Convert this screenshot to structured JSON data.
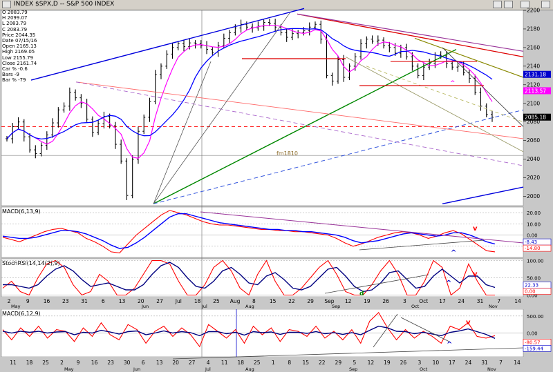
{
  "header": {
    "title": "INDEX $SPX,D -- S&P 500 INDEX",
    "buttons": [
      "link-icon",
      "settings-icon",
      "zoom-icon",
      "close-icon"
    ]
  },
  "readout": [
    {
      "label": "Price",
      "value": "2044.35"
    },
    {
      "label": "Date",
      "value": "07/15/16"
    },
    {
      "label": "Open",
      "value": "2165.13"
    },
    {
      "label": "High",
      "value": "2169.05"
    },
    {
      "label": "Low",
      "value": "2155.79"
    },
    {
      "label": "Close",
      "value": "2161.74"
    },
    {
      "label": "Car %",
      "value": "-0.6"
    },
    {
      "label": "Bars",
      "value": "-9"
    },
    {
      "label": "Bar %",
      "value": "-79"
    }
  ],
  "ohlc_box": {
    "O": "2083.79",
    "H": "2099.07",
    "L": "2083.79",
    "C": "2083.79"
  },
  "chart_data": [
    {
      "type": "candlestick",
      "title": "INDEX $SPX,D -- S&P 500 INDEX",
      "ylim": [
        1990,
        2200
      ],
      "y_ticks": [
        2000,
        2020,
        2040,
        2060,
        2080,
        2100,
        2120,
        2140,
        2160,
        2180,
        2200
      ],
      "price_labels": [
        {
          "text": "2131.18",
          "color": "#0000cc"
        },
        {
          "text": "2113.57",
          "color": "#ff00ff"
        },
        {
          "text": "2085.18",
          "color": "#000000"
        }
      ],
      "annotations": [
        "fm1810"
      ],
      "x_ticks_top": [
        "2",
        "9",
        "16",
        "23",
        "31",
        "6",
        "13",
        "20",
        "27",
        "Jul",
        "18",
        "25",
        "Aug",
        "8",
        "15",
        "22",
        "29",
        "Sep",
        "12",
        "19",
        "26",
        "3",
        "Oct",
        "17",
        "24",
        "31",
        "7",
        "14"
      ],
      "x_month_labels": [
        "May",
        "Jun",
        "Jul",
        "Aug",
        "Sep",
        "Oct",
        "Nov"
      ],
      "close_approx": [
        2062,
        2075,
        2080,
        2064,
        2050,
        2046,
        2055,
        2066,
        2079,
        2093,
        2097,
        2112,
        2106,
        2100,
        2083,
        2069,
        2078,
        2086,
        2076,
        2056,
        2038,
        2001,
        2040,
        2070,
        2085,
        2102,
        2131,
        2140,
        2153,
        2160,
        2164,
        2161,
        2165,
        2164,
        2162,
        2158,
        2155,
        2162,
        2170,
        2176,
        2181,
        2185,
        2182,
        2181,
        2183,
        2187,
        2186,
        2182,
        2176,
        2171,
        2175,
        2176,
        2178,
        2182,
        2185,
        2169,
        2130,
        2124,
        2147,
        2128,
        2140,
        2150,
        2164,
        2169,
        2167,
        2168,
        2162,
        2160,
        2154,
        2160,
        2150,
        2140,
        2130,
        2139,
        2143,
        2152,
        2151,
        2143,
        2139,
        2140,
        2133,
        2127,
        2112,
        2097,
        2088,
        2085
      ]
    },
    {
      "type": "line",
      "title": "MACD(6,13,9)",
      "ylim": [
        -20,
        25
      ],
      "y_ticks": [
        -10,
        0,
        10,
        20
      ],
      "y_tick_labels": [
        "-10",
        "0.00",
        "10.00",
        "20.00"
      ],
      "value_labels": [
        {
          "text": "-8.43",
          "color": "#0000cc"
        },
        {
          "text": "-14.80",
          "color": "#ff0000"
        }
      ],
      "series": [
        {
          "name": "MACD",
          "color": "#ff0000",
          "values": [
            -2,
            -4,
            -6,
            -3,
            0,
            3,
            5,
            6,
            4,
            2,
            -3,
            -6,
            -10,
            -15,
            -16,
            -8,
            0,
            6,
            12,
            18,
            22,
            20,
            18,
            15,
            12,
            10,
            9,
            9,
            8,
            7,
            6,
            5,
            5,
            4,
            4,
            3,
            3,
            2,
            1,
            0,
            -3,
            -7,
            -10,
            -8,
            -5,
            -2,
            0,
            2,
            3,
            2,
            0,
            -3,
            -1,
            2,
            4,
            1,
            -4,
            -9,
            -14,
            -15
          ]
        },
        {
          "name": "Signal",
          "color": "#0000ff",
          "values": [
            -1,
            -2,
            -3,
            -3,
            -2,
            0,
            2,
            4,
            4,
            3,
            1,
            -2,
            -5,
            -9,
            -12,
            -11,
            -7,
            -2,
            4,
            10,
            16,
            19,
            19,
            17,
            15,
            13,
            11,
            10,
            9,
            8,
            7,
            6,
            5,
            5,
            4,
            4,
            3,
            3,
            2,
            1,
            0,
            -2,
            -5,
            -7,
            -6,
            -5,
            -3,
            -1,
            1,
            2,
            1,
            0,
            -1,
            0,
            2,
            2,
            0,
            -3,
            -6,
            -8
          ]
        }
      ]
    },
    {
      "type": "line",
      "title": "StochRSI(14,14(2),9)",
      "ylim": [
        -5,
        105
      ],
      "y_ticks": [
        0,
        50,
        100
      ],
      "y_tick_labels": [
        "0.00",
        "50.00",
        "100.00"
      ],
      "value_labels": [
        {
          "text": "22.33",
          "color": "#0000cc"
        },
        {
          "text": "0.00",
          "color": "#ff0000"
        }
      ],
      "series": [
        {
          "name": "StochRSI",
          "color": "#ff0000",
          "values": [
            20,
            40,
            10,
            0,
            50,
            90,
            100,
            80,
            30,
            0,
            10,
            60,
            40,
            0,
            0,
            20,
            60,
            100,
            100,
            90,
            40,
            0,
            0,
            30,
            80,
            100,
            70,
            20,
            0,
            60,
            100,
            40,
            0,
            0,
            20,
            50,
            80,
            100,
            60,
            10,
            0,
            0,
            30,
            70,
            100,
            60,
            0,
            0,
            40,
            100,
            80,
            0,
            20,
            90,
            40,
            0,
            0
          ]
        },
        {
          "name": "Signal",
          "color": "#000080",
          "values": [
            30,
            30,
            25,
            20,
            30,
            55,
            75,
            85,
            70,
            45,
            25,
            30,
            35,
            25,
            15,
            15,
            30,
            60,
            85,
            95,
            80,
            50,
            25,
            20,
            40,
            70,
            80,
            60,
            35,
            30,
            55,
            65,
            45,
            20,
            15,
            25,
            50,
            75,
            80,
            55,
            25,
            10,
            15,
            35,
            65,
            70,
            45,
            20,
            25,
            55,
            75,
            55,
            35,
            55,
            55,
            30,
            22
          ]
        }
      ]
    },
    {
      "type": "line",
      "title": "MACD(6,12,9)",
      "ylim": [
        -700,
        700
      ],
      "y_ticks": [
        500,
        0
      ],
      "y_tick_labels": [
        "500.00",
        "0.00"
      ],
      "value_labels": [
        {
          "text": "-80.57",
          "color": "#ff0000"
        },
        {
          "text": "-159.44",
          "color": "#0000cc"
        }
      ],
      "x_ticks": [
        "11",
        "18",
        "25",
        "2",
        "9",
        "16",
        "23",
        "30",
        "6",
        "13",
        "20",
        "27",
        "4",
        "11",
        "18",
        "25",
        "1",
        "8",
        "15",
        "22",
        "29",
        "5",
        "12",
        "19",
        "26",
        "3",
        "10",
        "17",
        "24",
        "31",
        "7",
        "14"
      ],
      "x_month_labels": [
        "May",
        "Jun",
        "Jul",
        "Aug",
        "Sep",
        "Oct",
        "Nov"
      ],
      "series": [
        {
          "name": "MACD",
          "color": "#ff0000",
          "values": [
            100,
            -200,
            150,
            -100,
            200,
            -150,
            100,
            50,
            -250,
            150,
            -100,
            300,
            -50,
            -200,
            250,
            100,
            -300,
            50,
            200,
            -100,
            150,
            -50,
            -400,
            250,
            50,
            -150,
            100,
            -300,
            200,
            -50,
            150,
            -250,
            100,
            50,
            -100,
            200,
            -150,
            50,
            -200,
            100,
            -300,
            350,
            600,
            150,
            -200,
            100,
            -150,
            50,
            -100,
            -300,
            200,
            100,
            300,
            -100,
            -150,
            -80
          ]
        },
        {
          "name": "Signal",
          "color": "#000080",
          "values": [
            50,
            0,
            50,
            20,
            50,
            0,
            30,
            40,
            -50,
            20,
            0,
            80,
            30,
            -30,
            40,
            60,
            -50,
            0,
            60,
            0,
            40,
            10,
            -80,
            40,
            40,
            -20,
            20,
            -60,
            40,
            10,
            30,
            -40,
            20,
            20,
            -10,
            40,
            -20,
            10,
            -40,
            10,
            -50,
            80,
            200,
            150,
            50,
            40,
            -20,
            20,
            -30,
            -80,
            20,
            60,
            120,
            40,
            -40,
            -159
          ]
        }
      ]
    }
  ],
  "indicator_titles": {
    "macd1": "MACD(6,13,9)",
    "stoch": "StochRSI(14,14(2),9)",
    "macd2": "MACD(6,12,9)"
  },
  "marks": {
    "red_v": "v",
    "blue_caret": "^",
    "magenta_caret": "^",
    "green_d": "d"
  },
  "colors": {
    "pane_bg": "#ffffff",
    "frame_bg": "#c8c8c8",
    "price_ma_fast": "#ff00ff",
    "price_ma_slow": "#0000ff",
    "macd_red": "#ff0000",
    "macd_blue": "#0000ff"
  }
}
